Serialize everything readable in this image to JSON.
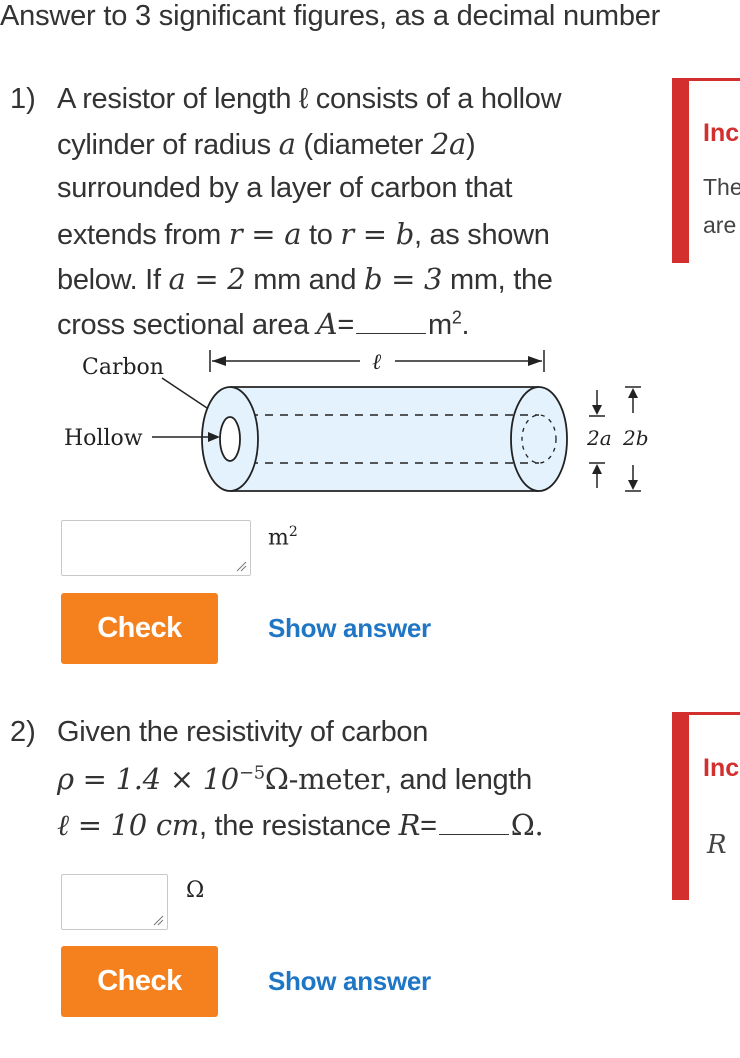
{
  "instruction": "Answer to 3 significant figures, as a decimal number",
  "q1": {
    "number": "1)",
    "line1": "A resistor of length ℓ consists of a hollow",
    "line2_a": "cylinder of radius ",
    "line2_b": "a",
    "line2_c": " (diameter ",
    "line2_d": "2a",
    "line2_e": ")",
    "line3": "surrounded by a layer of carbon that",
    "line4_a": "extends from ",
    "line4_b": "r = a",
    "line4_c": " to ",
    "line4_d": "r = b",
    "line4_e": ", as shown",
    "line5_a": "below. If ",
    "line5_b": "a = 2",
    "line5_c": " mm and ",
    "line5_d": "b = 3",
    "line5_e": " mm, the",
    "line6_a": "cross sectional area ",
    "line6_b": "A",
    "line6_c": "=",
    "line6_d": "m",
    "line6_sup": "2",
    "line6_e": ".",
    "unit": "m",
    "unit_sup": "2",
    "check_label": "Check",
    "show_answer_label": "Show answer",
    "figure": {
      "carbon_label": "Carbon",
      "hollow_label": "Hollow",
      "length_label": "ℓ",
      "dim_2a": "2a",
      "dim_2b": "2b"
    },
    "panel": {
      "title": "Inc",
      "text1": "The",
      "text2": "are"
    }
  },
  "q2": {
    "number": "2)",
    "line1": "Given the resistivity of carbon",
    "line2_a": "ρ = 1.4 × 10",
    "line2_sup": "−5",
    "line2_b": "Ω-meter",
    "line2_c": ", and length",
    "line3_a": "ℓ = 10 cm",
    "line3_b": ", the resistance ",
    "line3_c": "R",
    "line3_d": "=",
    "line3_e": "Ω.",
    "unit": "Ω",
    "check_label": "Check",
    "show_answer_label": "Show answer",
    "panel": {
      "title": "Inc",
      "text1": "R"
    }
  }
}
